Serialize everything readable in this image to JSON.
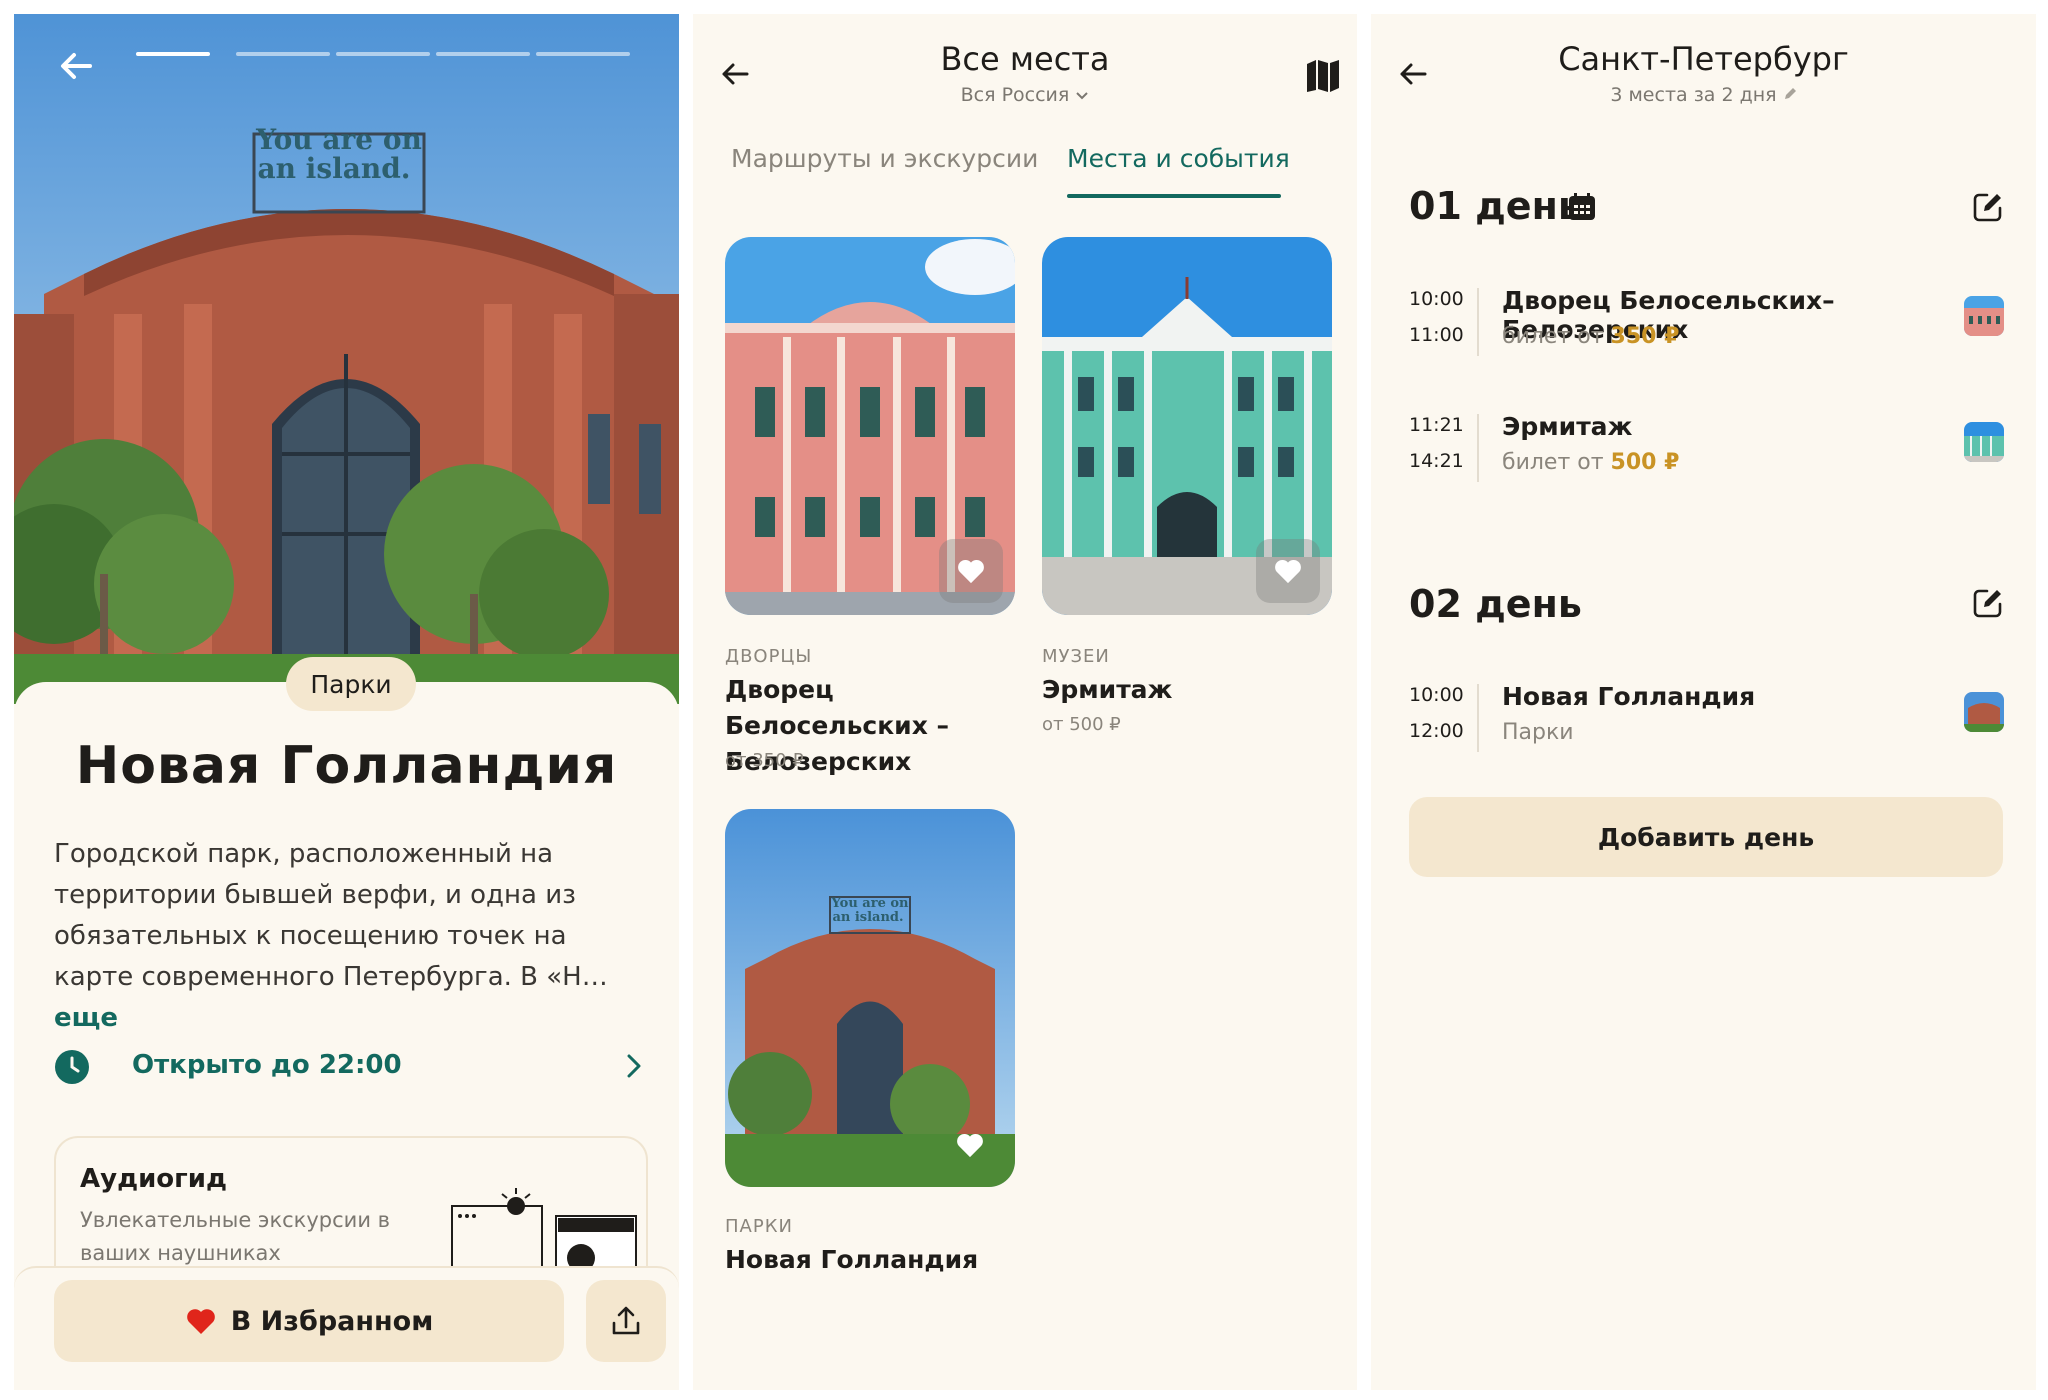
{
  "colors": {
    "background": "#fcf8f0",
    "accent_teal": "#13695f",
    "chip_beige": "#f4e7cf",
    "price_gold": "#c99325",
    "heart_red": "#e0251b"
  },
  "detail": {
    "back_icon": "arrow-left-icon",
    "story_progress": {
      "total": 5,
      "current": 1
    },
    "sign_lines": [
      "You are on",
      "an island."
    ],
    "chip": "Парки",
    "title": "Новая Голландия",
    "description": "Городской парк, расположенный на территории бывшей верфи, и одна из обязательных к посещению точек на карте современного Петербурга. В «Н…",
    "more_link": "еще",
    "hours": "Открыто до 22:00",
    "audioguide": {
      "title": "Аудиогид",
      "subtitle": "Увлекательные экскурсии в ваших наушниках"
    },
    "favorite_button": "В Избранном",
    "share_icon": "share-icon"
  },
  "catalog": {
    "title": "Все места",
    "region": "Вся Россия",
    "map_icon": "map-icon",
    "tabs": [
      {
        "label": "Маршруты и экскурсии",
        "active": false
      },
      {
        "label": "Места и события",
        "active": true
      }
    ],
    "cards": [
      {
        "category": "ДВОРЦЫ",
        "name": "Дворец Белосельских –Белозерских",
        "price": "от 350 ₽",
        "favorited": true
      },
      {
        "category": "МУЗЕИ",
        "name": "Эрмитаж",
        "price": "от 500 ₽",
        "favorited": true
      },
      {
        "category": "ПАРКИ",
        "name": "Новая Голландия",
        "price": "",
        "favorited": true
      }
    ]
  },
  "trip": {
    "title": "Санкт-Петербург",
    "subtitle": "3 места за 2 дня",
    "days": [
      {
        "label": "01 день",
        "items": [
          {
            "start": "10:00",
            "end": "11:00",
            "name": "Дворец Белосельских–Белозерских",
            "sub_prefix": "билет от",
            "price": "350 ₽"
          },
          {
            "start": "11:21",
            "end": "14:21",
            "name": "Эрмитаж",
            "sub_prefix": "билет от",
            "price": "500 ₽"
          }
        ]
      },
      {
        "label": "02 день",
        "items": [
          {
            "start": "10:00",
            "end": "12:00",
            "name": "Новая Голландия",
            "sub_prefix": "Парки",
            "price": ""
          }
        ]
      }
    ],
    "add_day_button": "Добавить день"
  }
}
